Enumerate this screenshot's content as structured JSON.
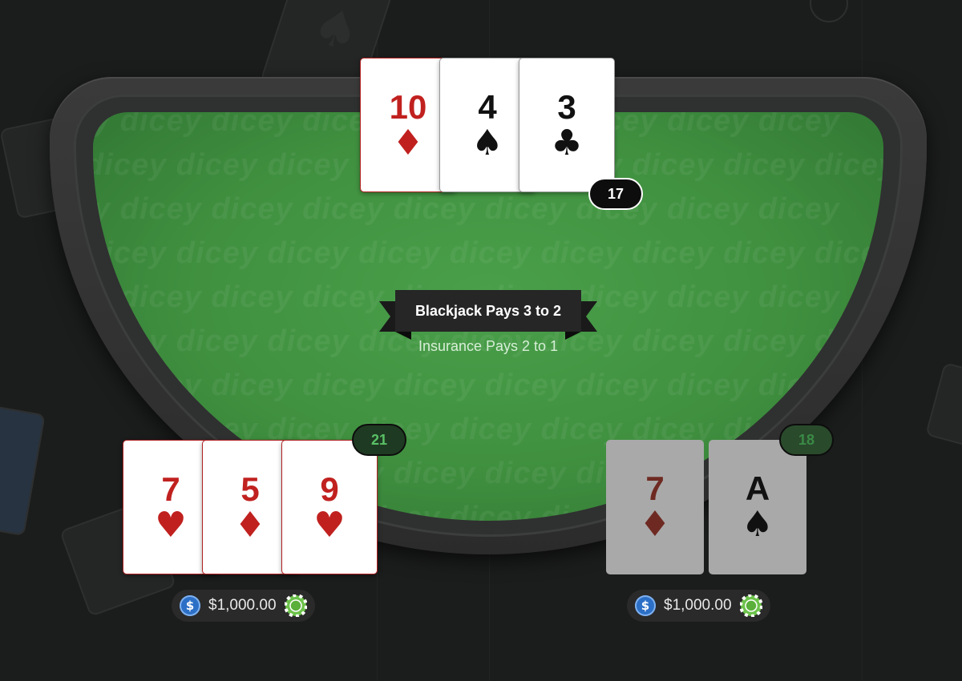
{
  "table": {
    "watermark": "dicey",
    "banner_title": "Blackjack Pays 3 to 2",
    "banner_subtitle": "Insurance Pays 2 to 1"
  },
  "dealer": {
    "cards": [
      {
        "rank": "10",
        "suit": "♦",
        "color": "red"
      },
      {
        "rank": "4",
        "suit": "♠",
        "color": "black"
      },
      {
        "rank": "3",
        "suit": "♣",
        "color": "black"
      }
    ],
    "score": "17"
  },
  "players": [
    {
      "cards": [
        {
          "rank": "7",
          "suit": "♥",
          "color": "red"
        },
        {
          "rank": "5",
          "suit": "♦",
          "color": "red"
        },
        {
          "rank": "9",
          "suit": "♥",
          "color": "red"
        }
      ],
      "score": "21",
      "balance": "$1,000.00"
    },
    {
      "cards": [
        {
          "rank": "7",
          "suit": "♦",
          "color": "red"
        },
        {
          "rank": "A",
          "suit": "♠",
          "color": "black"
        }
      ],
      "score": "18",
      "balance": "$1,000.00"
    }
  ],
  "icons": {
    "currency": "usdc-coin-icon",
    "chip": "poker-chip-icon"
  },
  "colors": {
    "felt": "#3f8f3f",
    "card_red": "#c0211f",
    "score_green": "#59c066",
    "coin_blue": "#2c6fc6",
    "chip_green": "#6cc24a"
  }
}
